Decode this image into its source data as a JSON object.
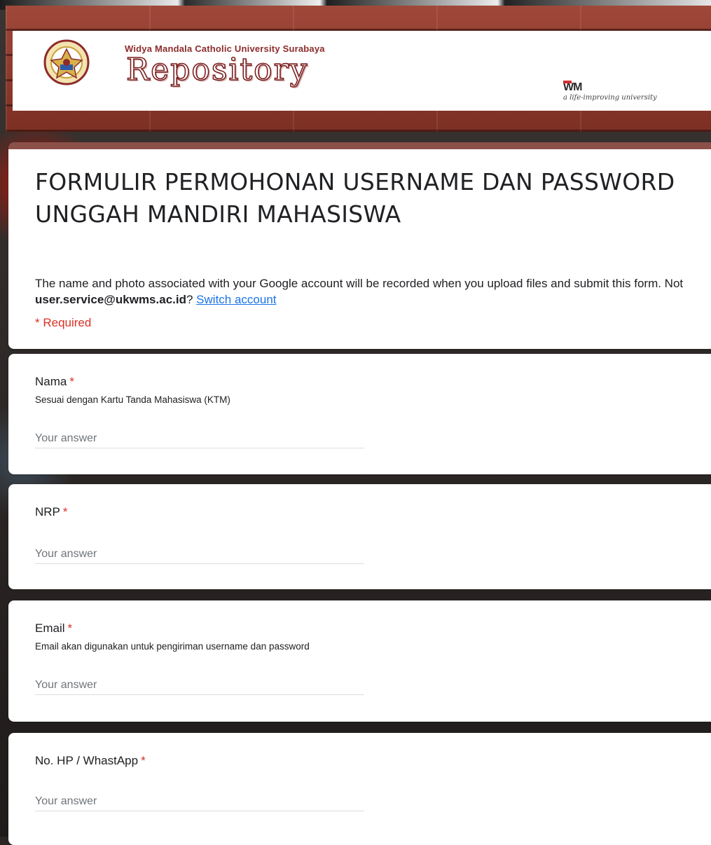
{
  "header": {
    "university_line": "Widya Mandala Catholic University Surabaya",
    "repository_word": "Repository",
    "brand_mark": "WM",
    "tagline": "a life-improving university"
  },
  "form": {
    "title": "FORMULIR PERMOHONAN USERNAME DAN PASSWORD UNGGAH MANDIRI MAHASISWA",
    "info_prefix": "The name and photo associated with your Google account will be recorded when you upload files and submit this form. Not ",
    "account_email": "user.service@ukwms.ac.id",
    "info_suffix": "? ",
    "switch_account": "Switch account",
    "required_note": "* Required"
  },
  "questions": [
    {
      "label": "Nama",
      "star": "*",
      "help": "Sesuai dengan Kartu Tanda Mahasiswa (KTM)",
      "placeholder": "Your answer"
    },
    {
      "label": "NRP",
      "star": "*",
      "help": "",
      "placeholder": "Your answer"
    },
    {
      "label": "Email",
      "star": "*",
      "help": "Email akan digunakan untuk pengiriman username dan password",
      "placeholder": "Your answer"
    },
    {
      "label": "No. HP / WhastApp",
      "star": "*",
      "help": "",
      "placeholder": "Your answer"
    }
  ],
  "colors": {
    "theme_accent": "#8b5048",
    "required_red": "#d93025",
    "link_blue": "#1a73e8"
  },
  "icons": [
    "university-crest-icon",
    "wm-logo-icon"
  ]
}
